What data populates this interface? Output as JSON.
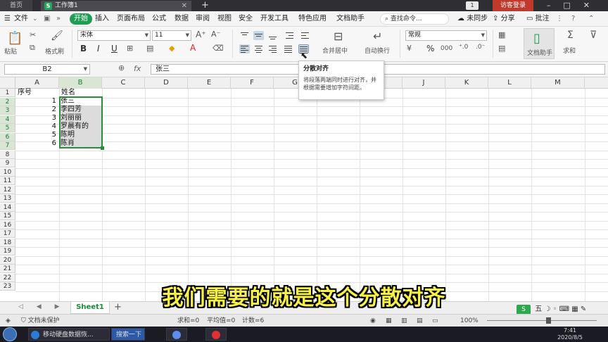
{
  "titlebar": {
    "home_tab": "首页",
    "doc_tab_icon": "S",
    "doc_tab": "工作簿1",
    "new_tab_icon": "plus-icon",
    "window_count": "1",
    "visitor_login": "访客登录"
  },
  "menu": {
    "file": "文件",
    "start": "开始",
    "items": [
      "插入",
      "页面布局",
      "公式",
      "数据",
      "审阅",
      "视图",
      "安全",
      "开发工具",
      "特色应用",
      "文档助手"
    ],
    "search_command": "查找命令...",
    "sync_status": "未同步",
    "share": "分享",
    "comment": "批注"
  },
  "ribbon": {
    "paste": "粘贴",
    "format_painter": "格式刷",
    "font_name": "宋体",
    "font_size": "11",
    "bold": "B",
    "italic": "I",
    "underline": "U",
    "font_color_letter": "A",
    "merge_center": "合并居中",
    "wrap_text": "自动换行",
    "number_format": "常规",
    "percent": "%",
    "thousands": "000",
    "doc_helper": "文档助手",
    "sum": "求和"
  },
  "formula_bar": {
    "cell_ref": "B2",
    "fx_label": "fx",
    "formula_value": "张三"
  },
  "tooltip": {
    "title": "分散对齐",
    "body": "将段落两端同时进行对齐，并根据需要增加字符间距。"
  },
  "grid": {
    "columns": [
      "A",
      "B",
      "C",
      "D",
      "E",
      "F",
      "G",
      "H",
      "I",
      "J",
      "K",
      "L",
      "M"
    ],
    "selected_column": "B",
    "row_count": 23,
    "headers": {
      "a1": "序号",
      "b1": "姓名"
    },
    "rows": [
      {
        "num": "1",
        "name": "张三"
      },
      {
        "num": "2",
        "name": "李四芳"
      },
      {
        "num": "3",
        "name": "刘丽丽"
      },
      {
        "num": "4",
        "name": "罗晨有的"
      },
      {
        "num": "5",
        "name": "陈明"
      },
      {
        "num": "6",
        "name": "陈肖"
      }
    ]
  },
  "sheets": {
    "active": "Sheet1",
    "add": "+"
  },
  "subtitle": "我们需要的就是这个分散对齐",
  "statusbar": {
    "protect": "文档未保护",
    "sum": "求和=0",
    "average": "平均值=0",
    "count": "计数=6",
    "zoom": "100%"
  },
  "taskbar": {
    "browser_item": "移动硬盘数据恢...",
    "search_item": "搜索一下",
    "time": "7:41",
    "date": "2020/8/5"
  },
  "colors": {
    "accent_green": "#1f9d55",
    "selection_green": "#2e8b3e",
    "subtitle_yellow": "#f6f048",
    "visitor_red": "#c0392b"
  }
}
